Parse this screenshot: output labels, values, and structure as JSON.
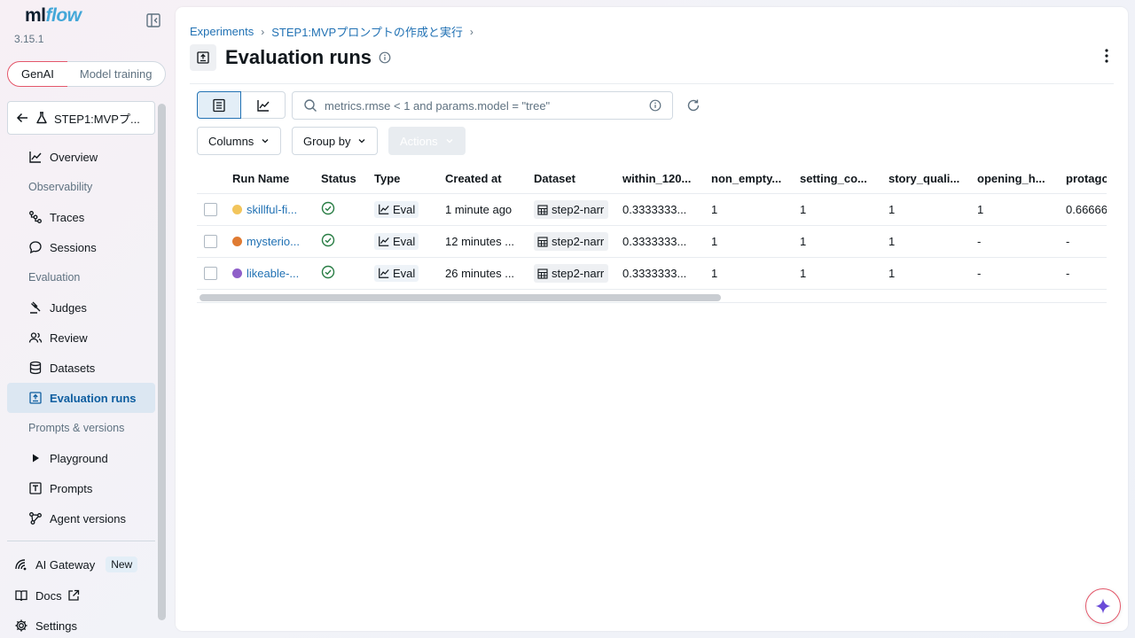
{
  "app": {
    "logo_ml": "ml",
    "logo_flow": "flow",
    "version": "3.15.1"
  },
  "mode_switch": {
    "genai": "GenAI",
    "model_training": "Model training"
  },
  "experiment": {
    "name": "STEP1:MVPプ..."
  },
  "nav": {
    "overview": "Overview",
    "observability": "Observability",
    "traces": "Traces",
    "sessions": "Sessions",
    "evaluation": "Evaluation",
    "judges": "Judges",
    "review": "Review",
    "datasets": "Datasets",
    "evaluation_runs": "Evaluation runs",
    "prompts_versions": "Prompts & versions",
    "playground": "Playground",
    "prompts": "Prompts",
    "agent_versions": "Agent versions"
  },
  "bottom_nav": {
    "ai_gateway": "AI Gateway",
    "new_badge": "New",
    "docs": "Docs",
    "settings": "Settings"
  },
  "breadcrumb": {
    "experiments": "Experiments",
    "experiment": "STEP1:MVPプロンプトの作成と実行"
  },
  "page": {
    "title": "Evaluation runs"
  },
  "toolbar": {
    "search_placeholder": "metrics.rmse < 1 and params.model = \"tree\"",
    "columns": "Columns",
    "group_by": "Group by",
    "actions": "Actions"
  },
  "table": {
    "headers": [
      "Run Name",
      "Status",
      "Type",
      "Created at",
      "Dataset",
      "within_120...",
      "non_empty...",
      "setting_co...",
      "story_quali...",
      "opening_h...",
      "protago"
    ],
    "rows": [
      {
        "name": "skillful-fi...",
        "color": "#f2c55c",
        "type": "Eval",
        "created": "1 minute ago",
        "dataset": "step2-narr",
        "m1": "0.3333333...",
        "m2": "1",
        "m3": "1",
        "m4": "1",
        "m5": "1",
        "m6": "0.66666"
      },
      {
        "name": "mysterio...",
        "color": "#e07b32",
        "type": "Eval",
        "created": "12 minutes ...",
        "dataset": "step2-narr",
        "m1": "0.3333333...",
        "m2": "1",
        "m3": "1",
        "m4": "1",
        "m5": "-",
        "m6": "-"
      },
      {
        "name": "likeable-...",
        "color": "#8f5fc9",
        "type": "Eval",
        "created": "26 minutes ...",
        "dataset": "step2-narr",
        "m1": "0.3333333...",
        "m2": "1",
        "m3": "1",
        "m4": "1",
        "m5": "-",
        "m6": "-"
      }
    ]
  }
}
